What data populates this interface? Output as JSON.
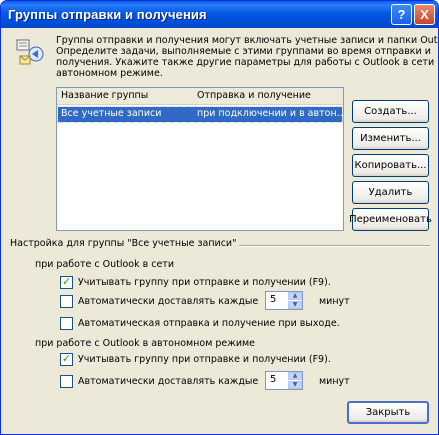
{
  "window": {
    "title": "Группы отправки и получения"
  },
  "titlebar": {
    "help_label": "?",
    "close_label": "X"
  },
  "description": {
    "icon": "send-receive-groups-icon",
    "lines": [
      "Группы отправки и получения могут включать учетные записи и папки Outlook.",
      "Определите задачи, выполняемые с этими группами во время отправки и",
      "получения. Укажите также другие параметры для работы с Outlook в сети и в",
      "автономном режиме."
    ]
  },
  "list": {
    "columns": [
      "Название группы",
      "Отправка и получение"
    ],
    "rows": [
      {
        "name": "Все учетные записи",
        "value": "при подключении и в автон..."
      }
    ]
  },
  "buttons": {
    "create": "Создать...",
    "edit": "Изменить...",
    "copy": "Копировать...",
    "delete": "Удалить",
    "rename": "Переименовать",
    "close": "Закрыть"
  },
  "settings": {
    "group_title": "Настройка для группы \"Все учетные записи\"",
    "online": {
      "title": "при работе с Outlook в сети",
      "include": {
        "label": "Учитывать группу при отправке и получении (F9).",
        "checked": true
      },
      "auto": {
        "label": "Автоматически доставлять каждые",
        "checked": false,
        "value": "5",
        "unit": "минут"
      },
      "on_exit": {
        "label": "Автоматическая отправка и получение при выходе.",
        "checked": false
      }
    },
    "offline": {
      "title": "при работе с Outlook в автономном режиме",
      "include": {
        "label": "Учитывать группу при отправке и получении (F9).",
        "checked": true
      },
      "auto": {
        "label": "Автоматически доставлять каждые",
        "checked": false,
        "value": "5",
        "unit": "минут"
      }
    }
  },
  "colors": {
    "title_bar": "#0058e6",
    "selection": "#316ac5",
    "dialog_bg": "#ece9d8"
  }
}
